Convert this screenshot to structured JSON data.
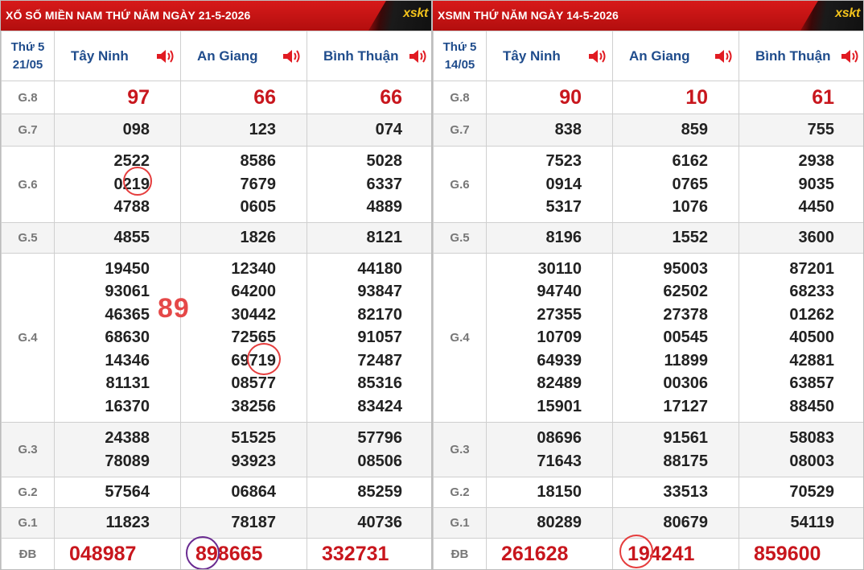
{
  "left": {
    "title": "XỔ SỐ MIỀN NAM THỨ NĂM NGÀY 21-5-2026",
    "logo": "xskt",
    "day_label": "Thứ 5",
    "date_label": "21/05",
    "provinces": [
      "Tây Ninh",
      "An Giang",
      "Bình Thuận"
    ],
    "prizes": [
      {
        "name": "G.8",
        "values": [
          [
            "97"
          ],
          [
            "66"
          ],
          [
            "66"
          ]
        ]
      },
      {
        "name": "G.7",
        "values": [
          [
            "098"
          ],
          [
            "123"
          ],
          [
            "074"
          ]
        ]
      },
      {
        "name": "G.6",
        "values": [
          [
            "2522",
            "0219",
            "4788"
          ],
          [
            "8586",
            "7679",
            "0605"
          ],
          [
            "5028",
            "6337",
            "4889"
          ]
        ]
      },
      {
        "name": "G.5",
        "values": [
          [
            "4855"
          ],
          [
            "1826"
          ],
          [
            "8121"
          ]
        ]
      },
      {
        "name": "G.4",
        "values": [
          [
            "19450",
            "93061",
            "46365",
            "68630",
            "14346",
            "81131",
            "16370"
          ],
          [
            "12340",
            "64200",
            "30442",
            "72565",
            "69719",
            "08577",
            "38256"
          ],
          [
            "44180",
            "93847",
            "82170",
            "91057",
            "72487",
            "85316",
            "83424"
          ]
        ]
      },
      {
        "name": "G.3",
        "values": [
          [
            "24388",
            "78089"
          ],
          [
            "51525",
            "93923"
          ],
          [
            "57796",
            "08506"
          ]
        ]
      },
      {
        "name": "G.2",
        "values": [
          [
            "57564"
          ],
          [
            "06864"
          ],
          [
            "85259"
          ]
        ]
      },
      {
        "name": "G.1",
        "values": [
          [
            "11823"
          ],
          [
            "78187"
          ],
          [
            "40736"
          ]
        ]
      },
      {
        "name": "ĐB",
        "values": [
          [
            "048987"
          ],
          [
            "898665"
          ],
          [
            "332731"
          ]
        ]
      }
    ],
    "annotation_number": "89"
  },
  "right": {
    "title": "XSMN THỨ NĂM NGÀY 14-5-2026",
    "logo": "xskt",
    "day_label": "Thứ 5",
    "date_label": "14/05",
    "provinces": [
      "Tây Ninh",
      "An Giang",
      "Bình Thuận"
    ],
    "prizes": [
      {
        "name": "G.8",
        "values": [
          [
            "90"
          ],
          [
            "10"
          ],
          [
            "61"
          ]
        ]
      },
      {
        "name": "G.7",
        "values": [
          [
            "838"
          ],
          [
            "859"
          ],
          [
            "755"
          ]
        ]
      },
      {
        "name": "G.6",
        "values": [
          [
            "7523",
            "0914",
            "5317"
          ],
          [
            "6162",
            "0765",
            "1076"
          ],
          [
            "2938",
            "9035",
            "4450"
          ]
        ]
      },
      {
        "name": "G.5",
        "values": [
          [
            "8196"
          ],
          [
            "1552"
          ],
          [
            "3600"
          ]
        ]
      },
      {
        "name": "G.4",
        "values": [
          [
            "30110",
            "94740",
            "27355",
            "10709",
            "64939",
            "82489",
            "15901"
          ],
          [
            "95003",
            "62502",
            "27378",
            "00545",
            "11899",
            "00306",
            "17127"
          ],
          [
            "87201",
            "68233",
            "01262",
            "40500",
            "42881",
            "63857",
            "88450"
          ]
        ]
      },
      {
        "name": "G.3",
        "values": [
          [
            "08696",
            "71643"
          ],
          [
            "91561",
            "88175"
          ],
          [
            "58083",
            "08003"
          ]
        ]
      },
      {
        "name": "G.2",
        "values": [
          [
            "18150"
          ],
          [
            "33513"
          ],
          [
            "70529"
          ]
        ]
      },
      {
        "name": "G.1",
        "values": [
          [
            "80289"
          ],
          [
            "80679"
          ],
          [
            "54119"
          ]
        ]
      },
      {
        "name": "ĐB",
        "values": [
          [
            "261628"
          ],
          [
            "194241"
          ],
          [
            "859600"
          ]
        ]
      }
    ]
  },
  "colors": {
    "header_red": "#c8161d",
    "province_blue": "#1f4c8c",
    "logo_gold": "#f2c21b",
    "mark_red": "#e53d3d",
    "mark_purple": "#6a2b91"
  },
  "icons": {
    "province_audio": "speaker-icon"
  }
}
